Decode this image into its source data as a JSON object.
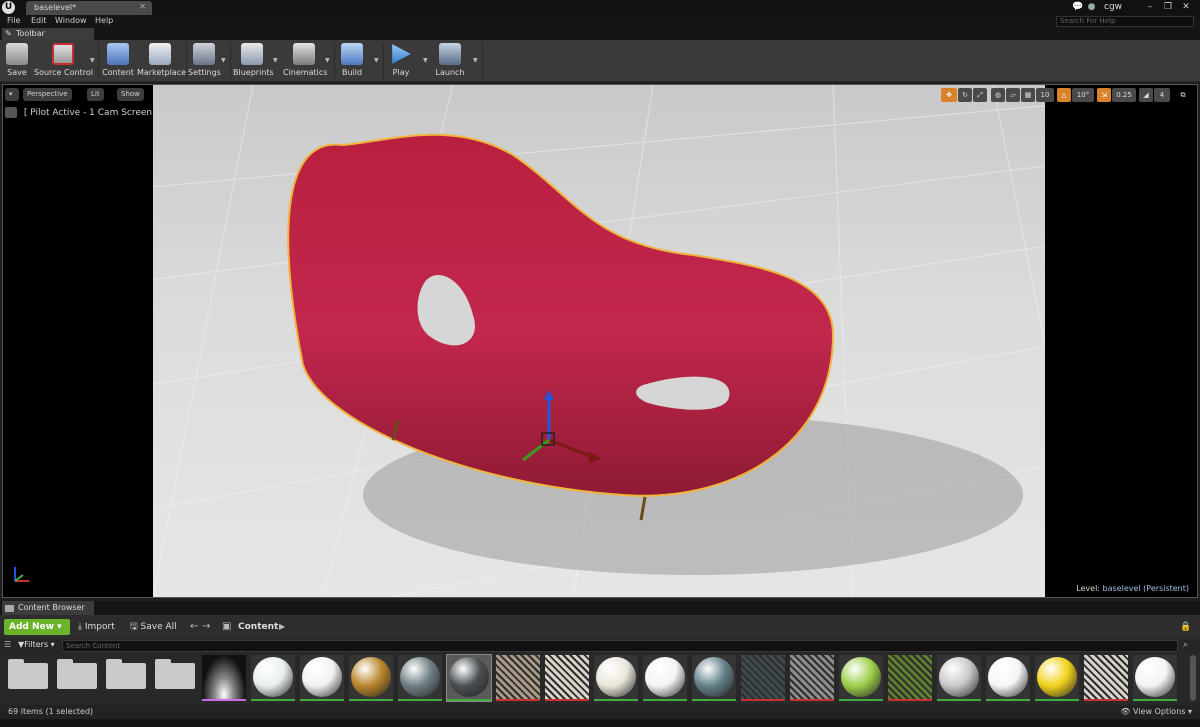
{
  "app": {
    "title": "baselevel*",
    "user": "cgw",
    "help_placeholder": "Search For Help"
  },
  "menu": [
    "File",
    "Edit",
    "Window",
    "Help"
  ],
  "toolbar_tab": "Toolbar",
  "toolbar": {
    "buttons": [
      {
        "label": "Save",
        "icon": "save-icon"
      },
      {
        "label": "Source Control",
        "icon": "source-control-icon"
      },
      {
        "label": "Content",
        "icon": "content-icon"
      },
      {
        "label": "Marketplace",
        "icon": "marketplace-icon"
      },
      {
        "label": "Settings",
        "icon": "settings-icon"
      },
      {
        "label": "Blueprints",
        "icon": "blueprints-icon"
      },
      {
        "label": "Cinematics",
        "icon": "cinematics-icon"
      },
      {
        "label": "Build",
        "icon": "build-icon"
      },
      {
        "label": "Play",
        "icon": "play-icon"
      },
      {
        "label": "Launch",
        "icon": "launch-icon"
      }
    ]
  },
  "viewport": {
    "perspective": "Perspective",
    "lit": "Lit",
    "show": "Show",
    "pilot": "[ Pilot Active - 1 Cam Screen ]",
    "grid_snap": "10",
    "rotation_snap": "10°",
    "scale_snap": "0.25",
    "camera_speed": "4",
    "level_prefix": "Level:",
    "level_name": "baselevel (Persistent)"
  },
  "content_browser": {
    "tab": "Content Browser",
    "add_new": "Add New",
    "import": "Import",
    "save_all": "Save All",
    "path": "Content",
    "filters": "Filters",
    "search_placeholder": "Search Content",
    "item_count": "69 items (1 selected)",
    "view_options": "View Options"
  },
  "assets": [
    {
      "kind": "folder"
    },
    {
      "kind": "folder"
    },
    {
      "kind": "folder"
    },
    {
      "kind": "folder"
    },
    {
      "kind": "hdr",
      "accent": "#c86ee0"
    },
    {
      "kind": "sphere",
      "color": "#e8eeee",
      "accent": "#3fae3f"
    },
    {
      "kind": "sphere",
      "color": "#f2f2f2",
      "accent": "#3fae3f"
    },
    {
      "kind": "sphere",
      "color": "#b8862b",
      "accent": "#3fae3f"
    },
    {
      "kind": "sphere",
      "color": "#6f7f86",
      "accent": "#3fae3f"
    },
    {
      "kind": "sphere",
      "color": "#4a4f52",
      "accent": "#3fae3f",
      "selected": true
    },
    {
      "kind": "texture",
      "color": "#a89a84",
      "accent": "#c83232"
    },
    {
      "kind": "texture",
      "color": "#d9d3c8",
      "accent": "#c83232"
    },
    {
      "kind": "sphere",
      "color": "#e9e6da",
      "accent": "#3fae3f"
    },
    {
      "kind": "sphere",
      "color": "#f4f4f4",
      "accent": "#3fae3f"
    },
    {
      "kind": "sphere",
      "color": "#64818a",
      "accent": "#3fae3f"
    },
    {
      "kind": "texture",
      "color": "#3e4a4e",
      "accent": "#c83232"
    },
    {
      "kind": "texture",
      "color": "#8c8c8c",
      "accent": "#c83232"
    },
    {
      "kind": "sphere",
      "color": "#9ccf4a",
      "accent": "#3fae3f"
    },
    {
      "kind": "texture",
      "color": "#5e7d2e",
      "accent": "#c83232"
    },
    {
      "kind": "sphere",
      "color": "#c9c9c9",
      "accent": "#3fae3f"
    },
    {
      "kind": "sphere",
      "color": "#f6f6f6",
      "accent": "#3fae3f"
    },
    {
      "kind": "sphere",
      "color": "#f1d21a",
      "accent": "#3fae3f"
    },
    {
      "kind": "texture",
      "color": "#d8d2ca",
      "accent": "#c83232"
    },
    {
      "kind": "sphere",
      "color": "#f3f3f3",
      "accent": "#3fae3f"
    }
  ],
  "colors": {
    "accent_orange": "#d9822b",
    "add_green": "#6bb32b",
    "chair_red": "#c2274c",
    "selection_outline": "#f0b43c"
  }
}
